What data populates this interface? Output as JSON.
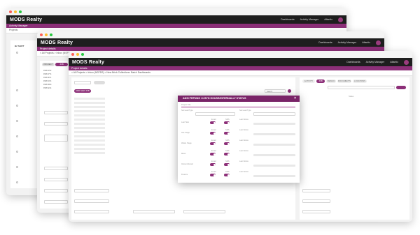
{
  "app": {
    "logo": "MODS Realty",
    "nav_dashboards": "Dashboards",
    "nav_activity_manager": "Activity Manager",
    "nav_atlantic": "Atlantic"
  },
  "windows": {
    "back": {
      "crumb": "Activity Manager",
      "subtitle": "Projects",
      "list_header": "BZ SHIFT"
    },
    "middle": {
      "crumb": "Project details",
      "breadcrumb": "< All Projects > Inbox (NSFDS)",
      "tab_projects": "PROJECT",
      "tab_job": "JOB",
      "list_items": [
        "DW8 8762",
        "DW8 9774",
        "DW8 8871",
        "DW8 8474",
        "DW8 9993",
        "DW8 8214"
      ]
    },
    "front": {
      "crumb": "Project details",
      "breadcrumb": "< All Projects > Inbox (NSFDS) > New Brick Collections: Batch Dashboards",
      "add_button": "ADD NEW JOB",
      "search_placeholder": "Search",
      "tabs": [
        "ACTIVITY",
        "JOB",
        "DESIGN",
        "DOCUMENTS",
        "LOCATIONS"
      ],
      "right_header": "Status"
    }
  },
  "modal": {
    "title": "ANSI PRFMNG 11 BYD HOUSE/INTERNALLY STATUS",
    "field_label": "Project Title",
    "select_a_label": "Set Lead Type",
    "select_b_label": "Set Lead Type",
    "rows": [
      {
        "label": "Last Task",
        "toggle_a": "Email",
        "toggle_b": "SMS",
        "note": "Last Notice"
      },
      {
        "label": "Site Stage",
        "toggle_a": "Email",
        "toggle_b": "SMS",
        "note": "Last Notice"
      },
      {
        "label": "Waste Stage",
        "toggle_a": "Email",
        "toggle_b": "SMS",
        "note": "Last Notice"
      },
      {
        "label": "Meter",
        "toggle_a": "Email",
        "toggle_b": "SMS",
        "note": "Last Notice"
      },
      {
        "label": "Inbound Email",
        "toggle_a": "Email",
        "toggle_b": "SMS",
        "note": "Last Notice"
      },
      {
        "label": "Finance",
        "toggle_a": "Email",
        "toggle_b": "SMS",
        "note": "Last Notice"
      }
    ]
  },
  "colors": {
    "brand": "#8c2f78",
    "brand_dark": "#7a2468",
    "navbar": "#1e1e1e",
    "dot_red": "#fc5f57",
    "dot_yellow": "#fdbc2e",
    "dot_green": "#28c840"
  }
}
